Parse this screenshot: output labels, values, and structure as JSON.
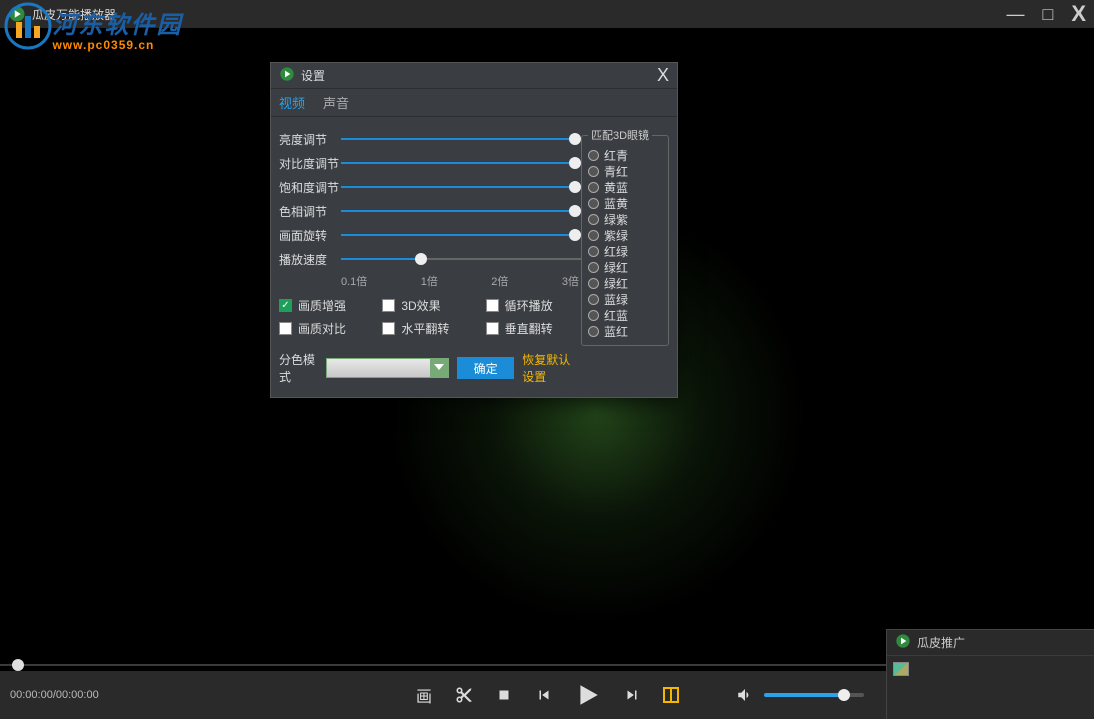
{
  "titlebar": {
    "app_name": "瓜皮万能播放器"
  },
  "watermark": {
    "title": "河东软件园",
    "url": "www.pc0359.cn"
  },
  "controls": {
    "time": "00:00:00/00:00:00",
    "pic_label": "画"
  },
  "side_panel": {
    "title": "瓜皮推广"
  },
  "dialog": {
    "title": "设置",
    "tabs": {
      "video": "视频",
      "audio": "声音"
    },
    "sliders": {
      "brightness": "亮度调节",
      "contrast": "对比度调节",
      "saturation": "饱和度调节",
      "hue": "色相调节",
      "rotation": "画面旋转",
      "speed": "播放速度"
    },
    "speed_scale": [
      "0.1倍",
      "1倍",
      "2倍",
      "3倍"
    ],
    "checks": {
      "enhance": "画质增强",
      "effect3d": "3D效果",
      "loop": "循环播放",
      "compare": "画质对比",
      "fliph": "水平翻转",
      "flipv": "垂直翻转"
    },
    "mode_label": "分色模式",
    "ok": "确定",
    "restore": "恢复默认设置",
    "glasses_legend": "匹配3D眼镜",
    "glasses": [
      "红青",
      "青红",
      "黄蓝",
      "蓝黄",
      "绿紫",
      "紫绿",
      "红绿",
      "绿红",
      "绿红",
      "蓝绿",
      "红蓝",
      "蓝红"
    ]
  }
}
